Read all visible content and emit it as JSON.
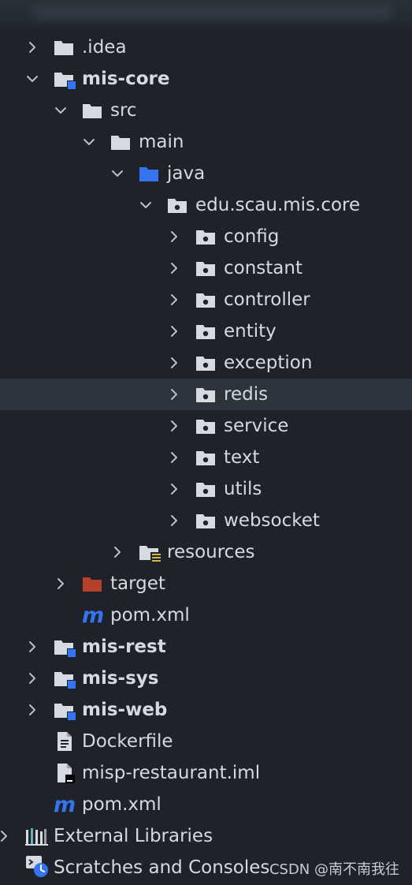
{
  "project_tree": {
    "rows": [
      {
        "label": "idea",
        "display": ".idea"
      },
      {
        "label": "mis-core"
      },
      {
        "label": "src"
      },
      {
        "label": "main"
      },
      {
        "label": "java"
      },
      {
        "label": "edu.scau.mis.core"
      },
      {
        "label": "config"
      },
      {
        "label": "constant"
      },
      {
        "label": "controller"
      },
      {
        "label": "entity"
      },
      {
        "label": "exception"
      },
      {
        "label": "redis"
      },
      {
        "label": "service"
      },
      {
        "label": "text"
      },
      {
        "label": "utils"
      },
      {
        "label": "websocket"
      },
      {
        "label": "resources"
      },
      {
        "label": "target"
      },
      {
        "label": "pom.xml"
      },
      {
        "label": "mis-rest"
      },
      {
        "label": "mis-sys"
      },
      {
        "label": "mis-web"
      },
      {
        "label": "Dockerfile"
      },
      {
        "label": "misp-restaurant.iml"
      },
      {
        "label": "pom.xml"
      },
      {
        "label": "External Libraries"
      },
      {
        "label": "Scratches and Consoles"
      }
    ],
    "selected": "redis"
  },
  "watermark": "CSDN @南不南我往",
  "colors": {
    "background": "#1f2329",
    "selection": "#2e343c",
    "text": "#d6d9de",
    "folder": "#d7dae0",
    "source_folder": "#3574f0",
    "excluded_folder": "#b6412a",
    "module_badge": "#3574f0",
    "maven_m": "#3574f0",
    "resources_badge": "#d4b845"
  }
}
